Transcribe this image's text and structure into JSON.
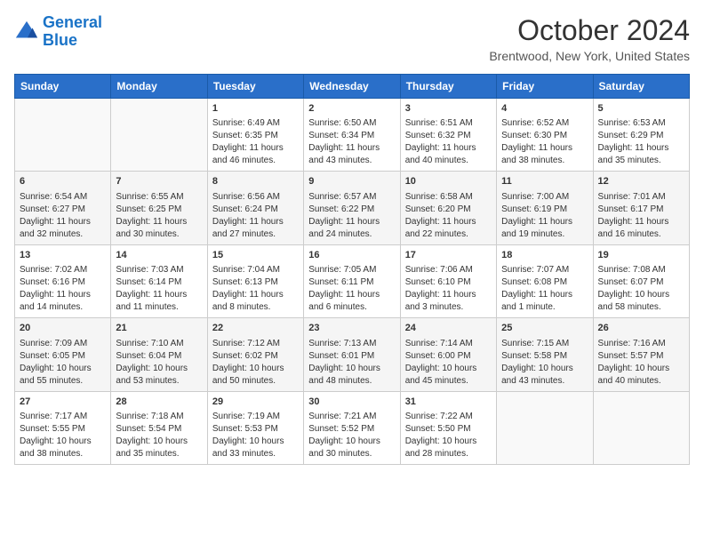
{
  "header": {
    "logo_line1": "General",
    "logo_line2": "Blue",
    "month": "October 2024",
    "location": "Brentwood, New York, United States"
  },
  "days_of_week": [
    "Sunday",
    "Monday",
    "Tuesday",
    "Wednesday",
    "Thursday",
    "Friday",
    "Saturday"
  ],
  "weeks": [
    [
      {
        "day": "",
        "empty": true
      },
      {
        "day": "",
        "empty": true
      },
      {
        "day": "1",
        "sunrise": "Sunrise: 6:49 AM",
        "sunset": "Sunset: 6:35 PM",
        "daylight": "Daylight: 11 hours and 46 minutes."
      },
      {
        "day": "2",
        "sunrise": "Sunrise: 6:50 AM",
        "sunset": "Sunset: 6:34 PM",
        "daylight": "Daylight: 11 hours and 43 minutes."
      },
      {
        "day": "3",
        "sunrise": "Sunrise: 6:51 AM",
        "sunset": "Sunset: 6:32 PM",
        "daylight": "Daylight: 11 hours and 40 minutes."
      },
      {
        "day": "4",
        "sunrise": "Sunrise: 6:52 AM",
        "sunset": "Sunset: 6:30 PM",
        "daylight": "Daylight: 11 hours and 38 minutes."
      },
      {
        "day": "5",
        "sunrise": "Sunrise: 6:53 AM",
        "sunset": "Sunset: 6:29 PM",
        "daylight": "Daylight: 11 hours and 35 minutes."
      }
    ],
    [
      {
        "day": "6",
        "sunrise": "Sunrise: 6:54 AM",
        "sunset": "Sunset: 6:27 PM",
        "daylight": "Daylight: 11 hours and 32 minutes."
      },
      {
        "day": "7",
        "sunrise": "Sunrise: 6:55 AM",
        "sunset": "Sunset: 6:25 PM",
        "daylight": "Daylight: 11 hours and 30 minutes."
      },
      {
        "day": "8",
        "sunrise": "Sunrise: 6:56 AM",
        "sunset": "Sunset: 6:24 PM",
        "daylight": "Daylight: 11 hours and 27 minutes."
      },
      {
        "day": "9",
        "sunrise": "Sunrise: 6:57 AM",
        "sunset": "Sunset: 6:22 PM",
        "daylight": "Daylight: 11 hours and 24 minutes."
      },
      {
        "day": "10",
        "sunrise": "Sunrise: 6:58 AM",
        "sunset": "Sunset: 6:20 PM",
        "daylight": "Daylight: 11 hours and 22 minutes."
      },
      {
        "day": "11",
        "sunrise": "Sunrise: 7:00 AM",
        "sunset": "Sunset: 6:19 PM",
        "daylight": "Daylight: 11 hours and 19 minutes."
      },
      {
        "day": "12",
        "sunrise": "Sunrise: 7:01 AM",
        "sunset": "Sunset: 6:17 PM",
        "daylight": "Daylight: 11 hours and 16 minutes."
      }
    ],
    [
      {
        "day": "13",
        "sunrise": "Sunrise: 7:02 AM",
        "sunset": "Sunset: 6:16 PM",
        "daylight": "Daylight: 11 hours and 14 minutes."
      },
      {
        "day": "14",
        "sunrise": "Sunrise: 7:03 AM",
        "sunset": "Sunset: 6:14 PM",
        "daylight": "Daylight: 11 hours and 11 minutes."
      },
      {
        "day": "15",
        "sunrise": "Sunrise: 7:04 AM",
        "sunset": "Sunset: 6:13 PM",
        "daylight": "Daylight: 11 hours and 8 minutes."
      },
      {
        "day": "16",
        "sunrise": "Sunrise: 7:05 AM",
        "sunset": "Sunset: 6:11 PM",
        "daylight": "Daylight: 11 hours and 6 minutes."
      },
      {
        "day": "17",
        "sunrise": "Sunrise: 7:06 AM",
        "sunset": "Sunset: 6:10 PM",
        "daylight": "Daylight: 11 hours and 3 minutes."
      },
      {
        "day": "18",
        "sunrise": "Sunrise: 7:07 AM",
        "sunset": "Sunset: 6:08 PM",
        "daylight": "Daylight: 11 hours and 1 minute."
      },
      {
        "day": "19",
        "sunrise": "Sunrise: 7:08 AM",
        "sunset": "Sunset: 6:07 PM",
        "daylight": "Daylight: 10 hours and 58 minutes."
      }
    ],
    [
      {
        "day": "20",
        "sunrise": "Sunrise: 7:09 AM",
        "sunset": "Sunset: 6:05 PM",
        "daylight": "Daylight: 10 hours and 55 minutes."
      },
      {
        "day": "21",
        "sunrise": "Sunrise: 7:10 AM",
        "sunset": "Sunset: 6:04 PM",
        "daylight": "Daylight: 10 hours and 53 minutes."
      },
      {
        "day": "22",
        "sunrise": "Sunrise: 7:12 AM",
        "sunset": "Sunset: 6:02 PM",
        "daylight": "Daylight: 10 hours and 50 minutes."
      },
      {
        "day": "23",
        "sunrise": "Sunrise: 7:13 AM",
        "sunset": "Sunset: 6:01 PM",
        "daylight": "Daylight: 10 hours and 48 minutes."
      },
      {
        "day": "24",
        "sunrise": "Sunrise: 7:14 AM",
        "sunset": "Sunset: 6:00 PM",
        "daylight": "Daylight: 10 hours and 45 minutes."
      },
      {
        "day": "25",
        "sunrise": "Sunrise: 7:15 AM",
        "sunset": "Sunset: 5:58 PM",
        "daylight": "Daylight: 10 hours and 43 minutes."
      },
      {
        "day": "26",
        "sunrise": "Sunrise: 7:16 AM",
        "sunset": "Sunset: 5:57 PM",
        "daylight": "Daylight: 10 hours and 40 minutes."
      }
    ],
    [
      {
        "day": "27",
        "sunrise": "Sunrise: 7:17 AM",
        "sunset": "Sunset: 5:55 PM",
        "daylight": "Daylight: 10 hours and 38 minutes."
      },
      {
        "day": "28",
        "sunrise": "Sunrise: 7:18 AM",
        "sunset": "Sunset: 5:54 PM",
        "daylight": "Daylight: 10 hours and 35 minutes."
      },
      {
        "day": "29",
        "sunrise": "Sunrise: 7:19 AM",
        "sunset": "Sunset: 5:53 PM",
        "daylight": "Daylight: 10 hours and 33 minutes."
      },
      {
        "day": "30",
        "sunrise": "Sunrise: 7:21 AM",
        "sunset": "Sunset: 5:52 PM",
        "daylight": "Daylight: 10 hours and 30 minutes."
      },
      {
        "day": "31",
        "sunrise": "Sunrise: 7:22 AM",
        "sunset": "Sunset: 5:50 PM",
        "daylight": "Daylight: 10 hours and 28 minutes."
      },
      {
        "day": "",
        "empty": true
      },
      {
        "day": "",
        "empty": true
      }
    ]
  ]
}
